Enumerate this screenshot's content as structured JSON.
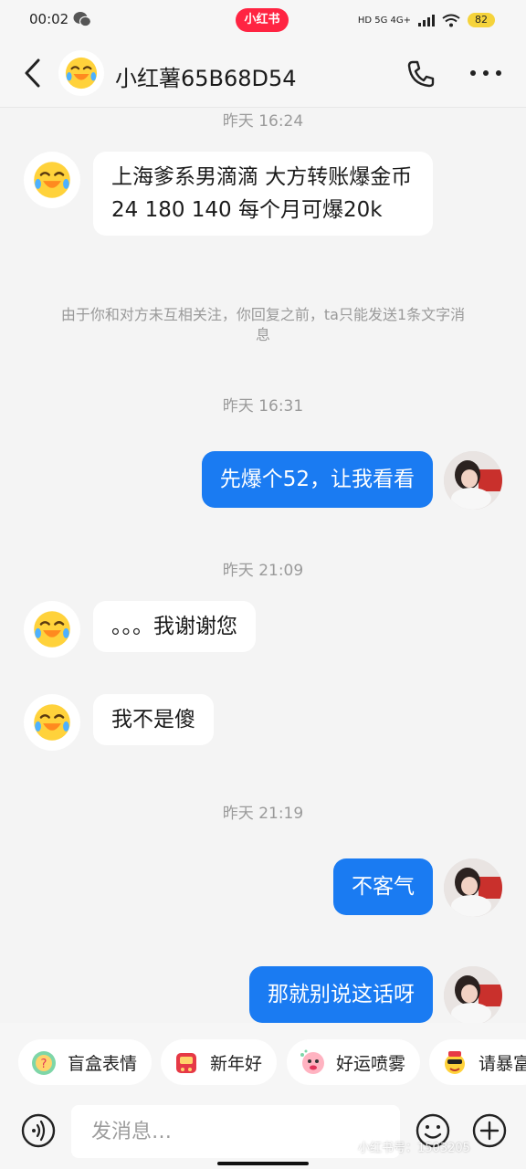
{
  "status_bar": {
    "time": "00:02",
    "brand": "小红书",
    "network": "HD 5G 4G+",
    "battery": "82"
  },
  "header": {
    "title": "小红薯65B68D54",
    "back_icon": "chevron-left-icon",
    "call_icon": "phone-icon",
    "more_icon": "more-dots-icon"
  },
  "messages": {
    "ts1": "昨天 16:24",
    "m1": "上海爹系男滴滴 大方转账爆金币\n24 180 140 每个月可爆20k",
    "notice": "由于你和对方未互相关注，你回复之前，ta只能发送1条文字消息",
    "ts2": "昨天 16:31",
    "m2": "先爆个52，让我看看",
    "ts3": "昨天 21:09",
    "m3": "。。。我谢谢您",
    "m4": "我不是傻",
    "ts4": "昨天 21:19",
    "m5": "不客气",
    "m6": "那就别说这话呀"
  },
  "quick_replies": [
    {
      "label": "盲盒表情",
      "icon": "blind-box-icon"
    },
    {
      "label": "新年好",
      "icon": "new-year-icon"
    },
    {
      "label": "好运喷雾",
      "icon": "lucky-spray-icon"
    },
    {
      "label": "请暴富",
      "icon": "get-rich-icon"
    }
  ],
  "input": {
    "placeholder": "发消息…"
  },
  "watermark": "小红书号：1503205",
  "colors": {
    "brand": "#ff2442",
    "sent_bubble": "#1a7bf2",
    "received_bubble": "#ffffff",
    "background": "#f4f4f4"
  }
}
